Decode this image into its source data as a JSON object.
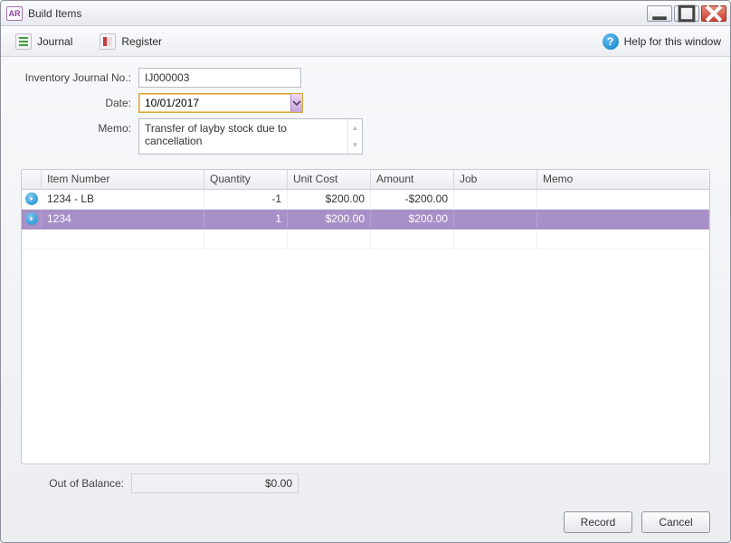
{
  "window": {
    "app_abbr": "AR",
    "title": "Build Items"
  },
  "toolbar": {
    "journal_label": "Journal",
    "register_label": "Register",
    "help_label": "Help for this window"
  },
  "form": {
    "journal_no_label": "Inventory Journal No.:",
    "journal_no_value": "IJ000003",
    "date_label": "Date:",
    "date_value": "10/01/2017",
    "memo_label": "Memo:",
    "memo_value": "Transfer of layby stock due to cancellation"
  },
  "grid": {
    "headers": {
      "item": "Item Number",
      "qty": "Quantity",
      "unit": "Unit Cost",
      "amount": "Amount",
      "job": "Job",
      "memo": "Memo"
    },
    "rows": [
      {
        "item": "1234 - LB",
        "qty": "-1",
        "unit": "$200.00",
        "amount": "-$200.00",
        "job": "",
        "memo": "",
        "selected": false
      },
      {
        "item": "1234",
        "qty": "1",
        "unit": "$200.00",
        "amount": "$200.00",
        "job": "",
        "memo": "",
        "selected": true
      }
    ]
  },
  "balance": {
    "label": "Out of Balance:",
    "value": "$0.00"
  },
  "footer": {
    "record_label": "Record",
    "cancel_label": "Cancel"
  }
}
